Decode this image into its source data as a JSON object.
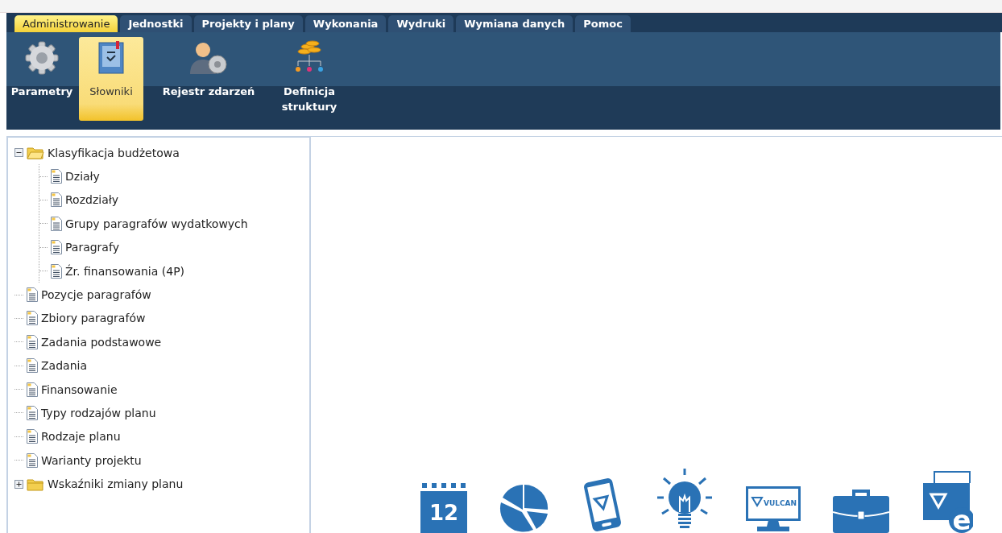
{
  "tabs": [
    {
      "label": "Administrowanie",
      "selected": true
    },
    {
      "label": "Jednostki",
      "selected": false
    },
    {
      "label": "Projekty i plany",
      "selected": false
    },
    {
      "label": "Wykonania",
      "selected": false
    },
    {
      "label": "Wydruki",
      "selected": false
    },
    {
      "label": "Wymiana danych",
      "selected": false
    },
    {
      "label": "Pomoc",
      "selected": false
    }
  ],
  "ribbon": [
    {
      "kind": "gear",
      "label": "Parametry",
      "selected": false
    },
    {
      "kind": "dictionary",
      "label": "Słowniki",
      "selected": true
    },
    {
      "kind": "user-gear",
      "label": "Rejestr zdarzeń",
      "selected": false
    },
    {
      "kind": "structure",
      "label": "Definicja struktury",
      "selected": false
    }
  ],
  "tree": [
    {
      "kind": "folder",
      "label": "Klasyfikacja budżetowa",
      "expanded": true,
      "children": [
        {
          "kind": "document",
          "label": "Działy"
        },
        {
          "kind": "document",
          "label": "Rozdziały"
        },
        {
          "kind": "document",
          "label": "Grupy paragrafów wydatkowych"
        },
        {
          "kind": "document",
          "label": "Paragrafy"
        },
        {
          "kind": "document",
          "label": "Źr. finansowania (4P)"
        }
      ]
    },
    {
      "kind": "document",
      "label": "Pozycje paragrafów"
    },
    {
      "kind": "document",
      "label": "Zbiory paragrafów"
    },
    {
      "kind": "document",
      "label": "Zadania podstawowe"
    },
    {
      "kind": "document",
      "label": "Zadania"
    },
    {
      "kind": "document",
      "label": "Finansowanie"
    },
    {
      "kind": "document",
      "label": "Typy rodzajów planu"
    },
    {
      "kind": "document",
      "label": "Rodzaje planu"
    },
    {
      "kind": "document",
      "label": "Warianty projektu"
    },
    {
      "kind": "folder",
      "label": "Wskaźniki zmiany planu",
      "expanded": false
    }
  ],
  "promo_icons": [
    {
      "kind": "calendar",
      "text": "12"
    },
    {
      "kind": "pie"
    },
    {
      "kind": "phone"
    },
    {
      "kind": "bulb"
    },
    {
      "kind": "monitor",
      "text": "VULCAN"
    },
    {
      "kind": "briefcase"
    },
    {
      "kind": "shop",
      "text": "e"
    }
  ]
}
